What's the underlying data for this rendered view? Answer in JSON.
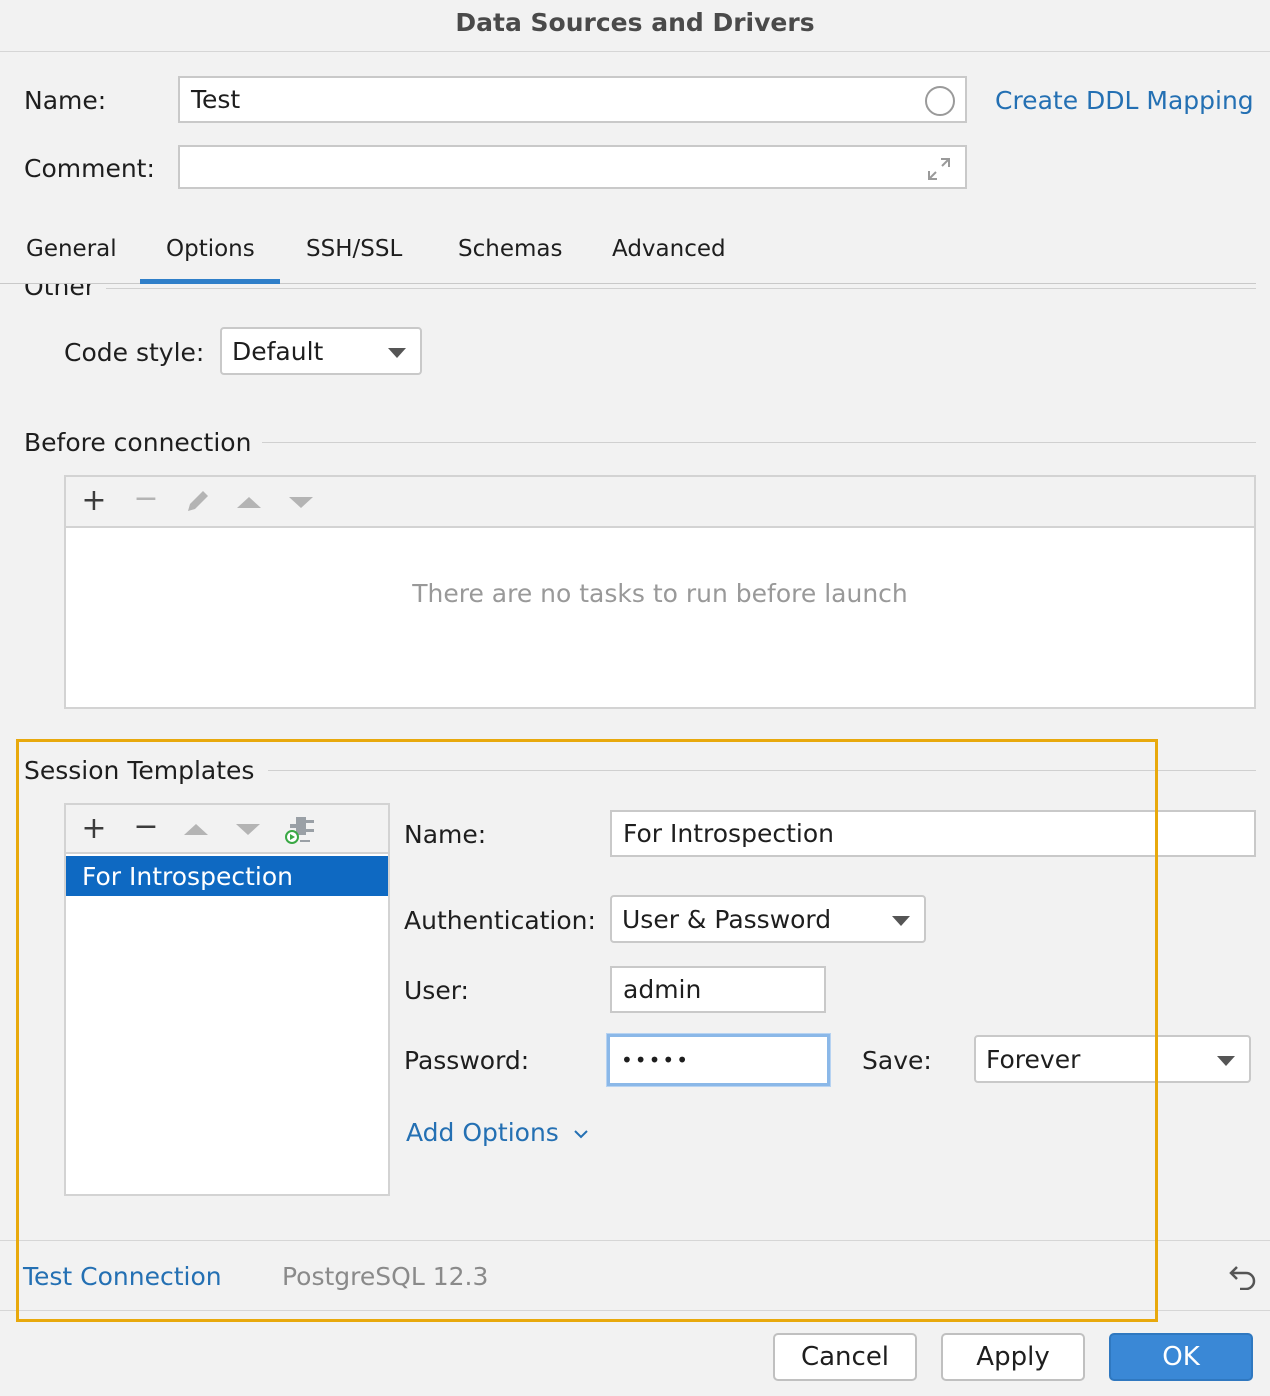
{
  "window": {
    "title": "Data Sources and Drivers"
  },
  "header": {
    "name_label": "Name:",
    "name_value": "Test",
    "comment_label": "Comment:",
    "comment_value": "",
    "ddl_link": "Create DDL Mapping"
  },
  "tabs": [
    {
      "label": "General",
      "active": false
    },
    {
      "label": "Options",
      "active": true
    },
    {
      "label": "SSH/SSL",
      "active": false
    },
    {
      "label": "Schemas",
      "active": false
    },
    {
      "label": "Advanced",
      "active": false
    }
  ],
  "other": {
    "section_label": "Other",
    "code_style_label": "Code style:",
    "code_style_value": "Default"
  },
  "before_connection": {
    "section_label": "Before connection",
    "empty_text": "There are no tasks to run before launch"
  },
  "session_templates": {
    "section_label": "Session Templates",
    "items": [
      "For Introspection"
    ],
    "selected_index": 0,
    "name_label": "Name:",
    "name_value": "For Introspection",
    "auth_label": "Authentication:",
    "auth_value": "User & Password",
    "user_label": "User:",
    "user_value": "admin",
    "password_label": "Password:",
    "password_value": "•••••",
    "save_label": "Save:",
    "save_value": "Forever",
    "add_options": "Add Options"
  },
  "footer": {
    "test_connection": "Test Connection",
    "driver_version": "PostgreSQL 12.3",
    "cancel": "Cancel",
    "apply": "Apply",
    "ok": "OK"
  },
  "colors": {
    "accent": "#2470b3",
    "selection": "#0e69c2",
    "highlight_frame": "#e8a90d"
  }
}
